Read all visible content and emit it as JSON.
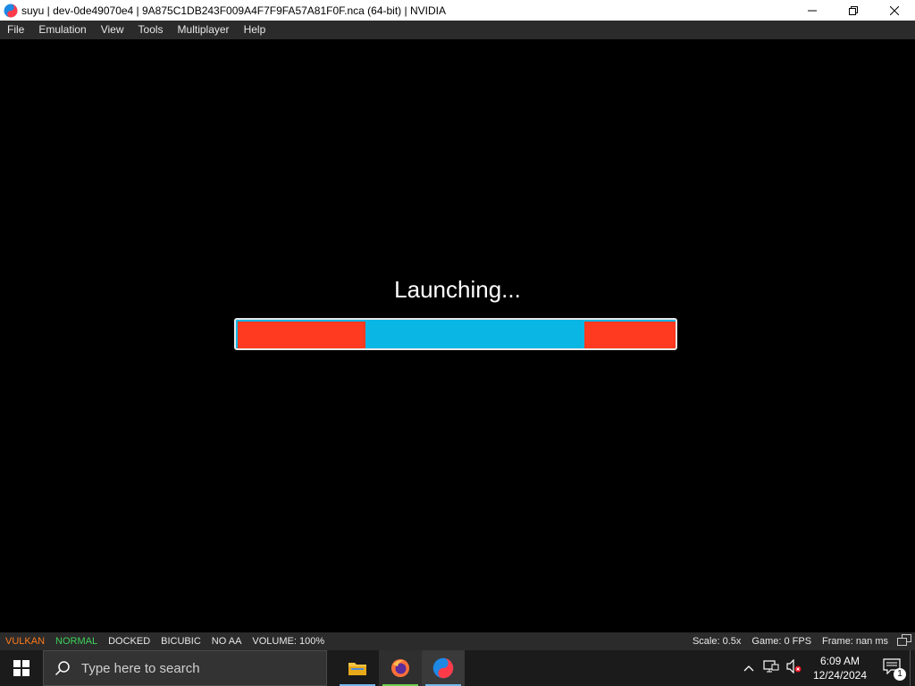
{
  "window": {
    "title": "suyu | dev-0de49070e4 | 9A875C1DB243F009A4F7F9FA57A81F0F.nca (64-bit) | NVIDIA"
  },
  "menu": {
    "items": [
      "File",
      "Emulation",
      "View",
      "Tools",
      "Multiplayer",
      "Help"
    ]
  },
  "viewport": {
    "launching_text": "Launching...",
    "progress_colors": {
      "bar": "#0ab6e4",
      "segments": "#ff3a20"
    }
  },
  "status": {
    "api": "VULKAN",
    "api_color": "#ff7a1a",
    "gpu_accuracy": "NORMAL",
    "gpu_accuracy_color": "#3cd35b",
    "dock_mode": "DOCKED",
    "filter": "BICUBIC",
    "aa": "NO AA",
    "volume": "VOLUME: 100%",
    "scale": "Scale: 0.5x",
    "game_fps": "Game: 0 FPS",
    "frame": "Frame: nan ms"
  },
  "taskbar": {
    "search_placeholder": "Type here to search",
    "time": "6:09 AM",
    "date": "12/24/2024",
    "notification_count": "1"
  }
}
